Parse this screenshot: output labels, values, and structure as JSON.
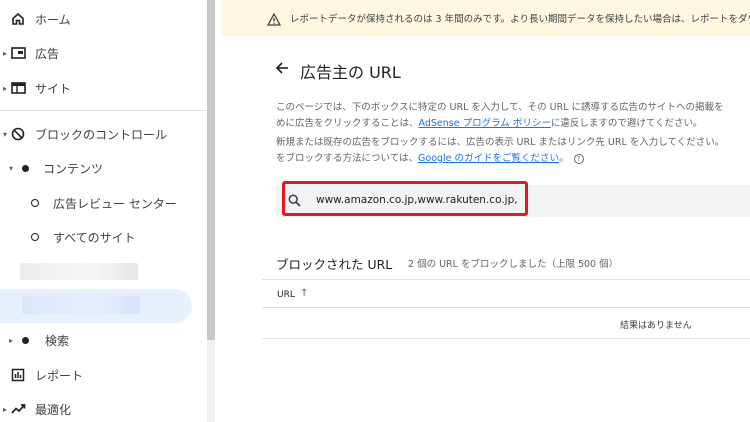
{
  "banner": {
    "text": "レポートデータが保持されるのは 3 年間のみです。より長い期間データを保持したい場合は、レポートをダウン"
  },
  "sidebar": {
    "items": [
      {
        "label": "ホーム",
        "icon": "home-icon"
      },
      {
        "label": "広告",
        "icon": "ads-icon"
      },
      {
        "label": "サイト",
        "icon": "sites-icon"
      },
      {
        "label": "ブロックのコントロール",
        "icon": "block-icon"
      },
      {
        "label": "コンテンツ",
        "icon": "dot-icon"
      },
      {
        "label": "広告レビュー センター",
        "icon": "ring-icon"
      },
      {
        "label": "すべてのサイト",
        "icon": "ring-icon"
      },
      {
        "label": "検索",
        "icon": "dot-icon"
      },
      {
        "label": "レポート",
        "icon": "reports-icon"
      },
      {
        "label": "最適化",
        "icon": "optimization-icon"
      }
    ]
  },
  "main": {
    "title": "広告主の URL",
    "desc_line1": "このページでは、下のボックスに特定の URL を入力して、その URL に誘導する広告のサイトへの掲載を",
    "desc_line2_pre": "めに広告をクリックすることは、",
    "desc_line2_link": "AdSense プログラム ポリシー",
    "desc_line2_post": "に違反しますので避けてください。",
    "desc_line3": "新規または既存の広告をブロックするには、広告の表示 URL またはリンク先 URL を入力してください。",
    "desc_line4_pre": "をブロックする方法については、",
    "desc_line4_link": "Google のガイドをご覧ください",
    "desc_line4_post": "。",
    "help_glyph": "?",
    "search_value": "www.amazon.co.jp,www.rakuten.co.jp,",
    "blocked_title": "ブロックされた URL",
    "blocked_count": "2 個の URL をブロックしました（上限 500 個）",
    "column_header": "URL",
    "sort_glyph": "↑",
    "empty_text": "結果はありません"
  }
}
